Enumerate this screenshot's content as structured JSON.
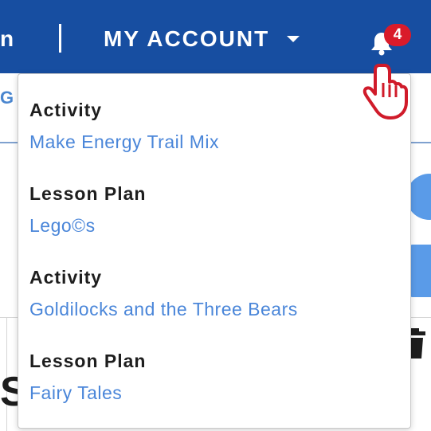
{
  "navbar": {
    "left_fragment": "n",
    "account_label": "MY ACCOUNT",
    "notification_count": "4",
    "colors": {
      "bar": "#174ea1",
      "badge": "#d91b2a"
    }
  },
  "background": {
    "left_text": "G",
    "big_letter": "S"
  },
  "notifications": [
    {
      "type": "Activity",
      "title": "Make Energy Trail Mix"
    },
    {
      "type": "Lesson Plan",
      "title": "Lego©s"
    },
    {
      "type": "Activity",
      "title": "Goldilocks and the Three Bears"
    },
    {
      "type": "Lesson Plan",
      "title": "Fairy Tales"
    }
  ],
  "icons": {
    "bell": "bell-icon",
    "caret": "chevron-down-icon",
    "cursor": "hand-pointer-icon",
    "trash": "trash-icon"
  },
  "colors": {
    "link": "#4a86d9",
    "heading": "#1e1e1e"
  }
}
